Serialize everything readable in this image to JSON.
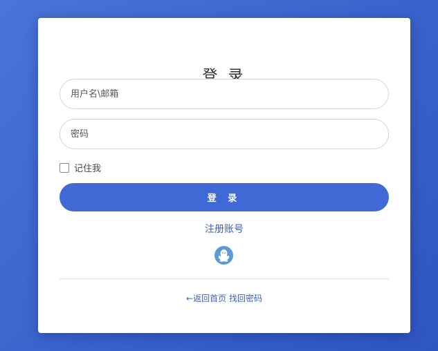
{
  "login": {
    "title": "登 录",
    "username_placeholder": "用户名\\邮箱",
    "password_placeholder": "密码",
    "remember_label": "记住我",
    "submit_label": "登 录",
    "register_link": "注册账号",
    "back_home_link": "←返回首页",
    "find_password_link": "找回密码",
    "social_icon": "qq-icon"
  },
  "colors": {
    "background": "#3a62cc",
    "primary_button": "#3f6ad6",
    "link": "#3a5fc4",
    "qq_icon": "#5b9bd5"
  }
}
